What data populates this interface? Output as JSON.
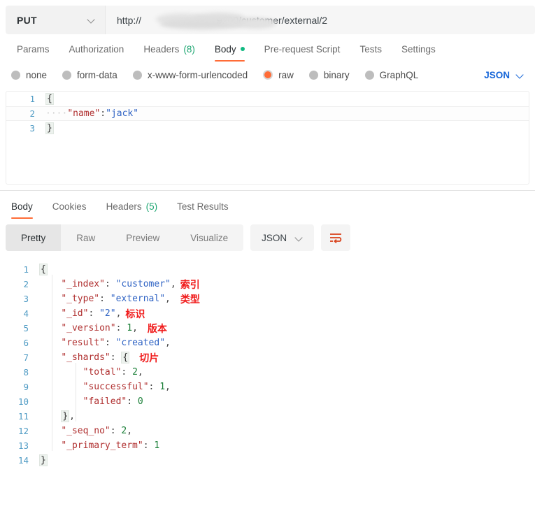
{
  "request": {
    "method": "PUT",
    "method_icon": "chevron-down-icon",
    "url_prefix": "http://",
    "url_suffix": "9200/customer/external/2",
    "url_redacted_note": "blurred-host-ip",
    "tabs": [
      {
        "label": "Params",
        "active": false
      },
      {
        "label": "Authorization",
        "active": false
      },
      {
        "label": "Headers",
        "count": "(8)",
        "active": false
      },
      {
        "label": "Body",
        "active": true,
        "dot": true
      },
      {
        "label": "Pre-request Script",
        "active": false
      },
      {
        "label": "Tests",
        "active": false
      },
      {
        "label": "Settings",
        "active": false
      }
    ],
    "body_types": [
      {
        "label": "none",
        "checked": false
      },
      {
        "label": "form-data",
        "checked": false
      },
      {
        "label": "x-www-form-urlencoded",
        "checked": false
      },
      {
        "label": "raw",
        "checked": true
      },
      {
        "label": "binary",
        "checked": false
      },
      {
        "label": "GraphQL",
        "checked": false
      }
    ],
    "raw_format": "JSON",
    "raw_format_icon": "chevron-down-icon",
    "body_lines": [
      {
        "no": "1",
        "indent": "",
        "key": "",
        "value": "",
        "brace": "{",
        "active": false
      },
      {
        "no": "2",
        "indent": "····",
        "key": "\"name\"",
        "colon": ":",
        "value": "\"jack\"",
        "active": true
      },
      {
        "no": "3",
        "indent": "",
        "key": "",
        "value": "",
        "brace": "}",
        "active": false
      }
    ]
  },
  "response": {
    "tabs": [
      {
        "label": "Body",
        "active": true
      },
      {
        "label": "Cookies",
        "active": false
      },
      {
        "label": "Headers",
        "count": "(5)",
        "active": false
      },
      {
        "label": "Test Results",
        "active": false
      }
    ],
    "view_modes": [
      {
        "label": "Pretty",
        "active": true
      },
      {
        "label": "Raw",
        "active": false
      },
      {
        "label": "Preview",
        "active": false
      },
      {
        "label": "Visualize",
        "active": false
      }
    ],
    "format": "JSON",
    "format_icon": "chevron-down-icon",
    "wrap_button_icon": "word-wrap-icon",
    "body_lines": [
      {
        "no": "1",
        "indent": 0,
        "brace": "{"
      },
      {
        "no": "2",
        "indent": 1,
        "key": "\"_index\"",
        "colon": ": ",
        "str": "\"customer\"",
        "tail": ",",
        "anno": "索引"
      },
      {
        "no": "3",
        "indent": 1,
        "key": "\"_type\"",
        "colon": ": ",
        "str": "\"external\"",
        "tail": ",",
        "anno": "类型",
        "anno_gap": 14
      },
      {
        "no": "4",
        "indent": 1,
        "key": "\"_id\"",
        "colon": ": ",
        "str": "\"2\"",
        "tail": ",",
        "anno": "标识"
      },
      {
        "no": "5",
        "indent": 1,
        "key": "\"_version\"",
        "colon": ": ",
        "num": "1",
        "tail": ",",
        "anno": "版本",
        "anno_gap": 14
      },
      {
        "no": "6",
        "indent": 1,
        "key": "\"result\"",
        "colon": ": ",
        "str": "\"created\"",
        "tail": ","
      },
      {
        "no": "7",
        "indent": 1,
        "key": "\"_shards\"",
        "colon": ": ",
        "brace": "{",
        "anno": "切片",
        "anno_gap": 14
      },
      {
        "no": "8",
        "indent": 2,
        "key": "\"total\"",
        "colon": ": ",
        "num": "2",
        "tail": ","
      },
      {
        "no": "9",
        "indent": 2,
        "key": "\"successful\"",
        "colon": ": ",
        "num": "1",
        "tail": ","
      },
      {
        "no": "10",
        "indent": 2,
        "key": "\"failed\"",
        "colon": ": ",
        "num": "0"
      },
      {
        "no": "11",
        "indent": 1,
        "brace": "}",
        "tail": ","
      },
      {
        "no": "12",
        "indent": 1,
        "key": "\"_seq_no\"",
        "colon": ": ",
        "num": "2",
        "tail": ","
      },
      {
        "no": "13",
        "indent": 1,
        "key": "\"_primary_term\"",
        "colon": ": ",
        "num": "1"
      },
      {
        "no": "14",
        "indent": 0,
        "brace": "}"
      }
    ]
  },
  "colors": {
    "accent_orange": "#ff6c37",
    "link_blue": "#1565d8",
    "count_green": "#1ea672",
    "json_key_red": "#b03030",
    "json_string_blue": "#2f63c4",
    "json_number_green": "#1a7f37",
    "annotation_red": "#f01a1a"
  }
}
